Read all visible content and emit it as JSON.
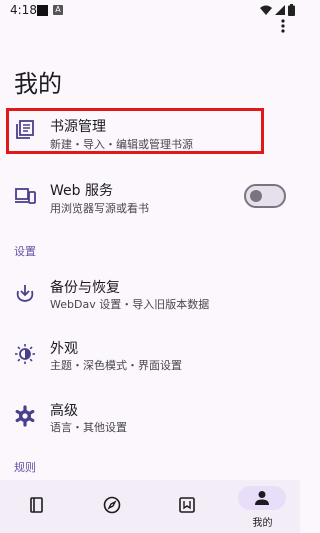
{
  "status_bar": {
    "time": "4:18",
    "notification_letter": "A"
  },
  "header": {
    "title": "我的"
  },
  "items": [
    {
      "title": "书源管理",
      "subtitle": "新建・导入・编辑或管理书源",
      "icon": "book-source-icon"
    },
    {
      "title": "Web 服务",
      "subtitle": "用浏览器写源或看书",
      "icon": "web-service-icon",
      "toggle_on": false
    },
    {
      "title": "备份与恢复",
      "subtitle": "WebDav 设置・导入旧版本数据",
      "icon": "backup-icon"
    },
    {
      "title": "外观",
      "subtitle": "主题・深色模式・界面设置",
      "icon": "brightness-icon"
    },
    {
      "title": "高级",
      "subtitle": "语言・其他设置",
      "icon": "gear-icon"
    }
  ],
  "sections": {
    "settings": "设置",
    "rules": "规则"
  },
  "bottom_nav": {
    "active_label": "我的",
    "tabs": [
      "bookshelf-icon",
      "compass-icon",
      "rss-icon",
      "person-icon"
    ]
  },
  "colors": {
    "accent": "#6750a4",
    "highlight": "#e01818",
    "background": "#fbf7fc",
    "nav_background": "#f3edf7"
  }
}
